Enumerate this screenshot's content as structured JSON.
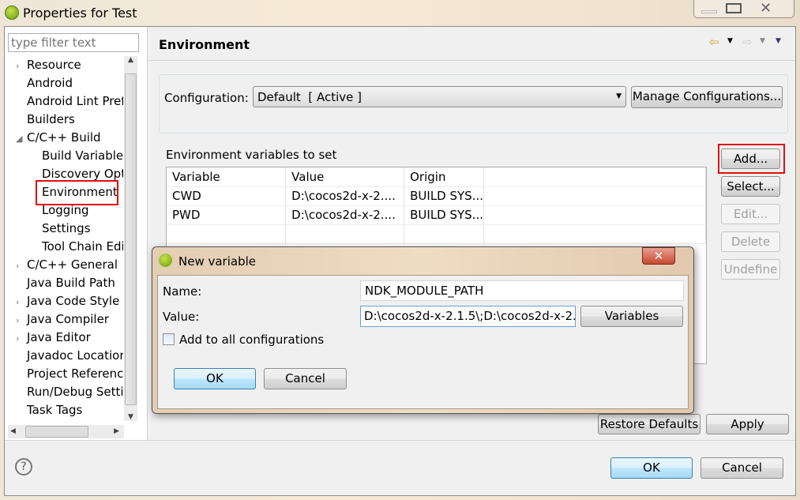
{
  "window": {
    "title": "Properties for Test"
  },
  "sidebar": {
    "filter_placeholder": "type filter text",
    "items": [
      {
        "label": "Resource",
        "level": 0,
        "twisty": "›"
      },
      {
        "label": "Android",
        "level": 0
      },
      {
        "label": "Android Lint Pref",
        "level": 0
      },
      {
        "label": "Builders",
        "level": 0
      },
      {
        "label": "C/C++ Build",
        "level": 0,
        "twisty": "◢"
      },
      {
        "label": "Build Variables",
        "level": 1
      },
      {
        "label": "Discovery Opt",
        "level": 1
      },
      {
        "label": "Environment",
        "level": 1,
        "selected": true
      },
      {
        "label": "Logging",
        "level": 1
      },
      {
        "label": "Settings",
        "level": 1
      },
      {
        "label": "Tool Chain Edi",
        "level": 1
      },
      {
        "label": "C/C++ General",
        "level": 0,
        "twisty": "›"
      },
      {
        "label": "Java Build Path",
        "level": 0
      },
      {
        "label": "Java Code Style",
        "level": 0,
        "twisty": "›"
      },
      {
        "label": "Java Compiler",
        "level": 0,
        "twisty": "›"
      },
      {
        "label": "Java Editor",
        "level": 0,
        "twisty": "›"
      },
      {
        "label": "Javadoc Location",
        "level": 0
      },
      {
        "label": "Project Referenc",
        "level": 0
      },
      {
        "label": "Run/Debug Setti",
        "level": 0
      },
      {
        "label": "Task Tags",
        "level": 0
      }
    ]
  },
  "page": {
    "title": "Environment",
    "config_label": "Configuration:",
    "config_value": "Default  [ Active ]",
    "manage_btn": "Manage Configurations...",
    "env_label": "Environment variables to set",
    "columns": [
      "Variable",
      "Value",
      "Origin"
    ],
    "rows": [
      [
        "CWD",
        "D:\\cocos2d-x-2....",
        "BUILD SYS..."
      ],
      [
        "PWD",
        "D:\\cocos2d-x-2....",
        "BUILD SYS..."
      ]
    ],
    "buttons": {
      "add": "Add...",
      "select": "Select...",
      "edit": "Edit...",
      "delete": "Delete",
      "undefine": "Undefine"
    },
    "restore": "Restore Defaults",
    "apply": "Apply"
  },
  "footer": {
    "ok": "OK",
    "cancel": "Cancel"
  },
  "dialog": {
    "title": "New variable",
    "name_label": "Name:",
    "name_value": "NDK_MODULE_PATH",
    "value_label": "Value:",
    "value_value": "D:\\cocos2d-x-2.1.5\\;D:\\cocos2d-x-2.",
    "variables_btn": "Variables",
    "checkbox_label": "Add to all configurations",
    "checked": false,
    "ok": "OK",
    "cancel": "Cancel"
  },
  "colors": {
    "highlight": "#e01010",
    "dialog_frame": "#d9c3a8"
  }
}
